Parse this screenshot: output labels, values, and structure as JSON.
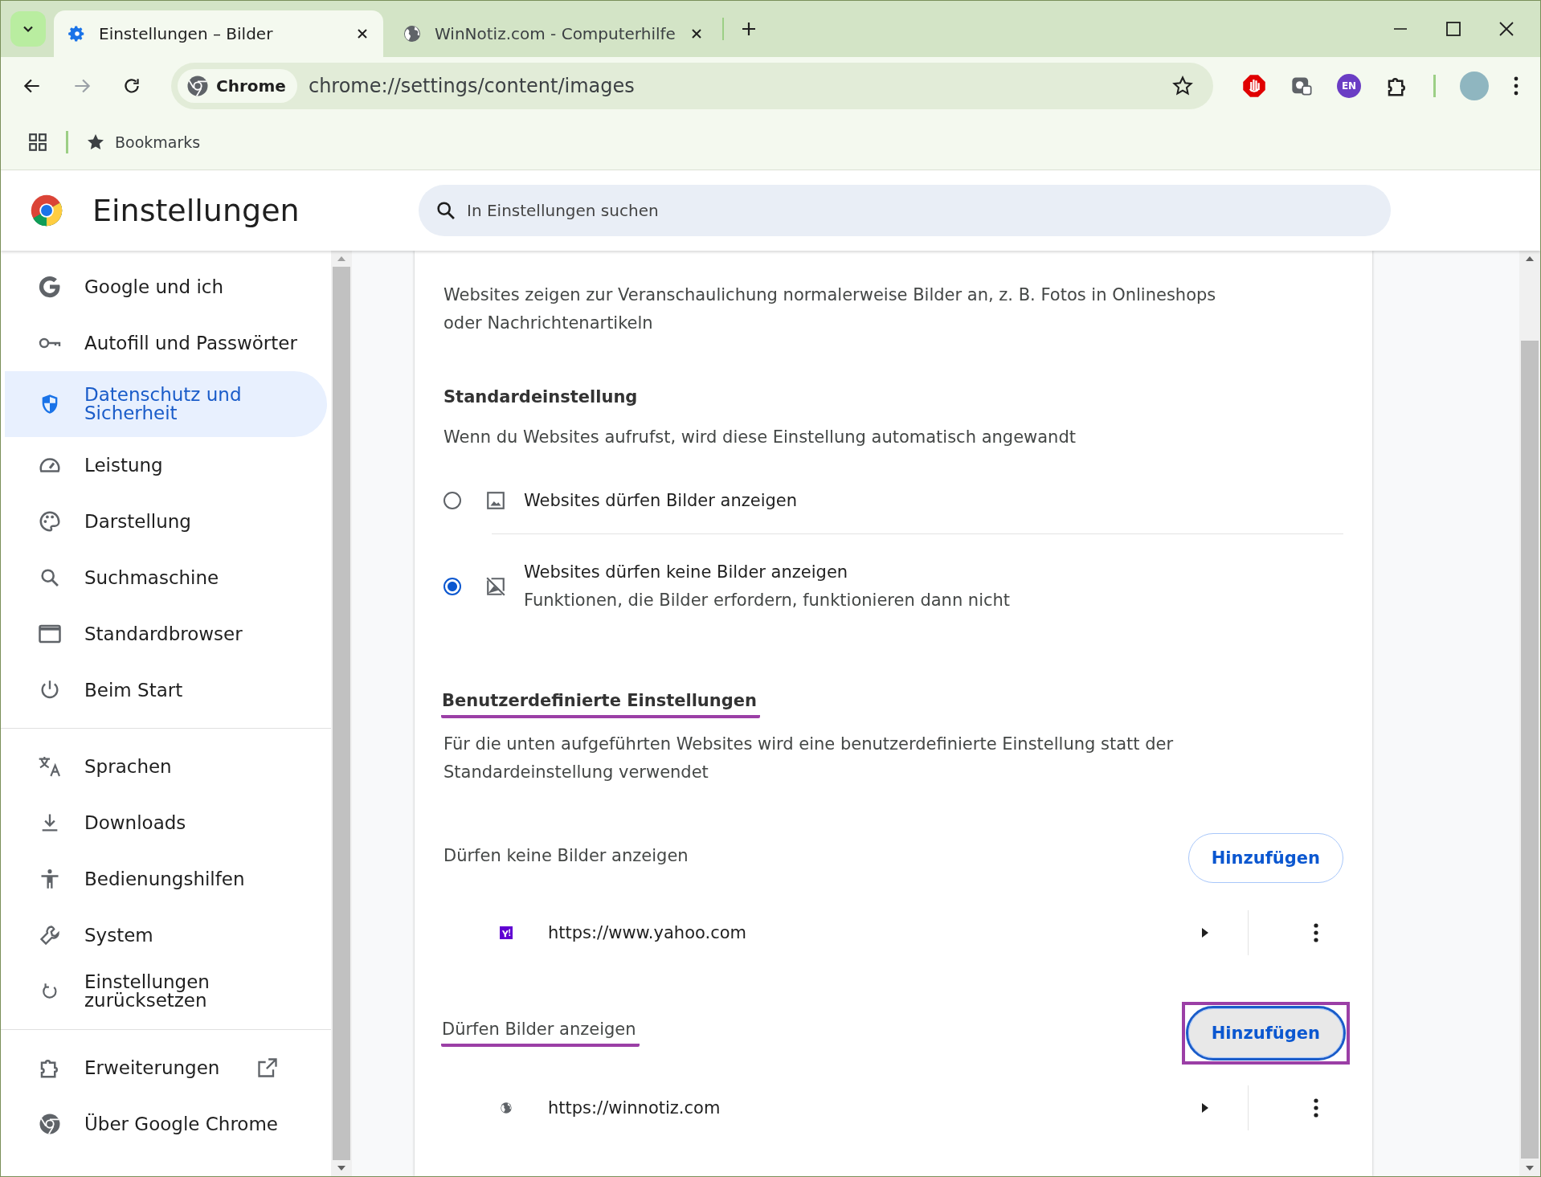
{
  "browser": {
    "tabs": [
      {
        "title": "Einstellungen – Bilder",
        "selected": true,
        "kind": "gear"
      },
      {
        "title": "WinNotiz.com - Computerhilfe",
        "selected": false,
        "kind": "globe"
      }
    ],
    "site_chip": "Chrome",
    "url": "chrome://settings/content/images",
    "profile_badge": "EN",
    "bookmarks": "Bookmarks"
  },
  "header": {
    "title": "Einstellungen",
    "search": {
      "placeholder": "In Einstellungen suchen"
    }
  },
  "sidebar": {
    "groups": [
      [
        {
          "label": "Google und ich",
          "kind": "google",
          "selected": false
        },
        {
          "label": "Autofill und Passwörter",
          "kind": "key",
          "selected": false
        },
        {
          "label": "Datenschutz und Sicherheit",
          "kind": "shield",
          "selected": true
        },
        {
          "label": "Leistung",
          "kind": "gauge",
          "selected": false
        },
        {
          "label": "Darstellung",
          "kind": "palette",
          "selected": false
        },
        {
          "label": "Suchmaschine",
          "kind": "search",
          "selected": false
        },
        {
          "label": "Standardbrowser",
          "kind": "window",
          "selected": false
        },
        {
          "label": "Beim Start",
          "kind": "power",
          "selected": false
        }
      ],
      [
        {
          "label": "Sprachen",
          "kind": "translate",
          "selected": false
        },
        {
          "label": "Downloads",
          "kind": "download",
          "selected": false
        },
        {
          "label": "Bedienungshilfen",
          "kind": "person",
          "selected": false
        },
        {
          "label": "System",
          "kind": "wrench",
          "selected": false
        },
        {
          "label": "Einstellungen zurücksetzen",
          "kind": "reset",
          "selected": false
        }
      ],
      [
        {
          "label": "Erweiterungen",
          "kind": "puzzle",
          "selected": false,
          "external": true
        },
        {
          "label": "Über Google Chrome",
          "kind": "chrome",
          "selected": false
        }
      ]
    ]
  },
  "content": {
    "intro": "Websites zeigen zur Veranschaulichung normalerweise Bilder an, z. B. Fotos in Onlineshops oder Nachrichtenartikeln",
    "default_heading": "Standardeinstellung",
    "default_desc": "Wenn du Websites aufrufst, wird diese Einstellung automatisch angewandt",
    "options": [
      {
        "label": "Websites dürfen Bilder anzeigen",
        "kind": "image",
        "selected": false
      },
      {
        "label": "Websites dürfen keine Bilder anzeigen",
        "sublabel": "Funktionen, die Bilder erfordern, funktionieren dann nicht",
        "kind": "no-image",
        "selected": true
      }
    ],
    "custom_heading": {
      "text": "Benutzerdefinierte Einstellungen",
      "highlighted": true
    },
    "custom_desc": "Für die unten aufgeführten Websites wird eine benutzerdefinierte Einstellung statt der Standardeinstellung verwendet",
    "sections": [
      {
        "heading": "Dürfen keine Bilder anzeigen",
        "highlighted": false,
        "button": {
          "label": "Hinzufügen",
          "focused": false,
          "highlighted": false
        },
        "sites": [
          {
            "url": "https://www.yahoo.com",
            "kind": "yahoo"
          }
        ]
      },
      {
        "heading": "Dürfen Bilder anzeigen",
        "highlighted": true,
        "button": {
          "label": "Hinzufügen",
          "focused": true,
          "highlighted": true
        },
        "sites": [
          {
            "url": "https://winnotiz.com",
            "kind": "globe"
          }
        ]
      }
    ]
  }
}
